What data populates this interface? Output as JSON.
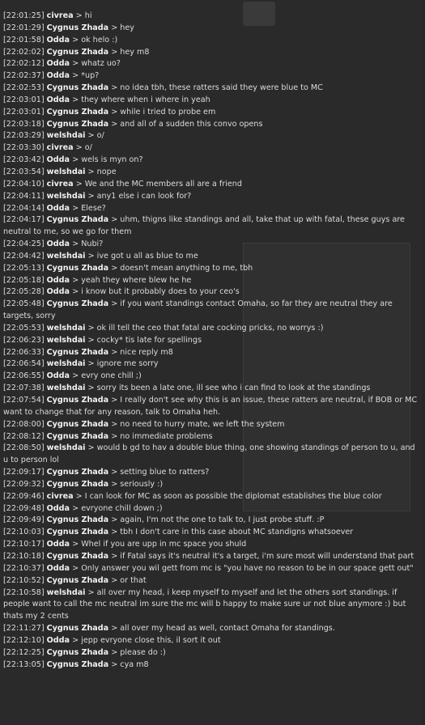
{
  "messages": [
    {
      "time": "[22:01:25]",
      "sender": "civrea",
      "text": "hi"
    },
    {
      "time": "[22:01:29]",
      "sender": "Cygnus Zhada",
      "text": "hey"
    },
    {
      "time": "[22:01:58]",
      "sender": "Odda",
      "text": "ok helo :)"
    },
    {
      "time": "[22:02:02]",
      "sender": "Cygnus Zhada",
      "text": "hey m8"
    },
    {
      "time": "[22:02:12]",
      "sender": "Odda",
      "text": "whatz uo?"
    },
    {
      "time": "[22:02:37]",
      "sender": "Odda",
      "text": "*up?"
    },
    {
      "time": "[22:02:53]",
      "sender": "Cygnus Zhada",
      "text": "no idea tbh, these ratters said they were blue to MC"
    },
    {
      "time": "[22:03:01]",
      "sender": "Odda",
      "text": "they where when i where in yeah"
    },
    {
      "time": "[22:03:01]",
      "sender": "Cygnus Zhada",
      "text": "while i tried to probe em"
    },
    {
      "time": "[22:03:18]",
      "sender": "Cygnus Zhada",
      "text": "and all of a sudden this convo opens"
    },
    {
      "time": "[22:03:29]",
      "sender": "welshdai",
      "text": "o/"
    },
    {
      "time": "[22:03:30]",
      "sender": "civrea",
      "text": "o/"
    },
    {
      "time": "[22:03:42]",
      "sender": "Odda",
      "text": "wels is myn on?"
    },
    {
      "time": "[22:03:54]",
      "sender": "welshdai",
      "text": "nope"
    },
    {
      "time": "[22:04:10]",
      "sender": "civrea",
      "text": "We and the MC members all are a friend"
    },
    {
      "time": "[22:04:11]",
      "sender": "welshdai",
      "text": "any1 else i can look for?"
    },
    {
      "time": "[22:04:14]",
      "sender": "Odda",
      "text": "Elese?"
    },
    {
      "time": "[22:04:17]",
      "sender": "Cygnus Zhada",
      "text": "uhm, thigns like standings and all, take that up with fatal, these guys are neutral to me, so we go for them"
    },
    {
      "time": "[22:04:25]",
      "sender": "Odda",
      "text": "Nubi?"
    },
    {
      "time": "[22:04:42]",
      "sender": "welshdai",
      "text": "ive got u all as blue to me"
    },
    {
      "time": "[22:05:13]",
      "sender": "Cygnus Zhada",
      "text": "doesn't mean anything to me, tbh"
    },
    {
      "time": "[22:05:18]",
      "sender": "Odda",
      "text": "yeah they where blew he he"
    },
    {
      "time": "[22:05:28]",
      "sender": "Odda",
      "text": "i know but it probably does to your ceo's"
    },
    {
      "time": "[22:05:48]",
      "sender": "Cygnus Zhada",
      "text": "if you want standings contact Omaha, so far they are neutral they are targets, sorry"
    },
    {
      "time": "[22:05:53]",
      "sender": "welshdai",
      "text": "ok ill tell the ceo that fatal are cocking pricks, no worrys :)"
    },
    {
      "time": "[22:06:23]",
      "sender": "welshdai",
      "text": "cocky* tis late for spellings"
    },
    {
      "time": "[22:06:33]",
      "sender": "Cygnus Zhada",
      "text": "nice reply m8"
    },
    {
      "time": "[22:06:54]",
      "sender": "welshdai",
      "text": "ignore me sorry"
    },
    {
      "time": "[22:06:55]",
      "sender": "Odda",
      "text": "evry one chill ;)"
    },
    {
      "time": "[22:07:38]",
      "sender": "welshdai",
      "text": "sorry its been a late one, ill see who i can find to look at the standings"
    },
    {
      "time": "[22:07:54]",
      "sender": "Cygnus Zhada",
      "text": "I really don't see why this is an issue, these ratters are neutral, if BOB or MC want to change that for any reason, talk to Omaha heh."
    },
    {
      "time": "[22:08:00]",
      "sender": "Cygnus Zhada",
      "text": "no need to hurry mate, we left the system"
    },
    {
      "time": "[22:08:12]",
      "sender": "Cygnus Zhada",
      "text": "no immediate problems"
    },
    {
      "time": "[22:08:50]",
      "sender": "welshdai",
      "text": "would b gd to hav a double blue thing, one showing standings of person to u, and u to person lol"
    },
    {
      "time": "[22:09:17]",
      "sender": "Cygnus Zhada",
      "text": "setting blue to ratters?"
    },
    {
      "time": "[22:09:32]",
      "sender": "Cygnus Zhada",
      "text": "seriously :)"
    },
    {
      "time": "[22:09:46]",
      "sender": "civrea",
      "text": "I can look for MC as soon as possible the diplomat establishes the blue color"
    },
    {
      "time": "[22:09:48]",
      "sender": "Odda",
      "text": "evryone chill down ;)"
    },
    {
      "time": "[22:09:49]",
      "sender": "Cygnus Zhada",
      "text": "again, I'm not the one to talk to, I just probe stuff. :P"
    },
    {
      "time": "[22:10:03]",
      "sender": "Cygnus Zhada",
      "text": "tbh I don't care in this case about MC standigns whatsoever"
    },
    {
      "time": "[22:10:17]",
      "sender": "Odda",
      "text": "Whel if you are upp in mc space you shuld"
    },
    {
      "time": "[22:10:18]",
      "sender": "Cygnus Zhada",
      "text": "if Fatal says it's neutral it's a target, i'm sure most will understand that part"
    },
    {
      "time": "[22:10:37]",
      "sender": "Odda",
      "text": "Only answer you wil gett from mc is \"you have no reason to be in our space gett out\""
    },
    {
      "time": "[22:10:52]",
      "sender": "Cygnus Zhada",
      "text": "or that"
    },
    {
      "time": "[22:10:58]",
      "sender": "welshdai",
      "text": "all over my head, i keep myself to myself and let the others sort standings. if people want to call the mc neutral im sure the mc will b happy to make sure ur not blue anymore :) but thats my 2 cents"
    },
    {
      "time": "[22:11:27]",
      "sender": "Cygnus Zhada",
      "text": "all over my head as well, contact Omaha for standings."
    },
    {
      "time": "[22:12:10]",
      "sender": "Odda",
      "text": "jepp evryone close this, il sort it out"
    },
    {
      "time": "[22:12:25]",
      "sender": "Cygnus Zhada",
      "text": "please do :)"
    },
    {
      "time": "[22:13:05]",
      "sender": "Cygnus Zhada",
      "text": "cya m8"
    }
  ],
  "separator": ">",
  "colors": {
    "background": "#2a2a2a",
    "text": "#dcdcdc",
    "sender": "#f2f2f2"
  }
}
